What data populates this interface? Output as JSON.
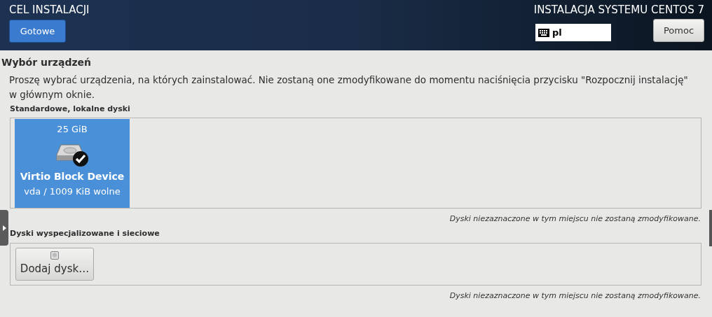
{
  "header": {
    "title": "CEL INSTALACJI",
    "done_button": "Gotowe",
    "product": "INSTALACJA SYSTEMU CENTOS 7",
    "keyboard_layout": "pl",
    "help_button": "Pomoc"
  },
  "page_title": "Wybór urządzeń",
  "intro": "Proszę wybrać urządzenia, na których zainstalować. Nie zostaną one zmodyfikowane do momentu naciśnięcia przycisku \"Rozpocznij instalację\" w głównym oknie.",
  "local_disks": {
    "heading": "Standardowe, lokalne dyski",
    "disks": [
      {
        "size": "25 GiB",
        "name": "Virtio Block Device",
        "detail": "vda / 1009 KiB wolne",
        "selected": true
      }
    ],
    "note": "Dyski niezaznaczone w tym miejscu nie zostaną zmodyfikowane."
  },
  "network_disks": {
    "heading": "Dyski wyspecjalizowane i sieciowe",
    "add_button": "Dodaj dysk…",
    "note": "Dyski niezaznaczone w tym miejscu nie zostaną zmodyfikowane."
  }
}
